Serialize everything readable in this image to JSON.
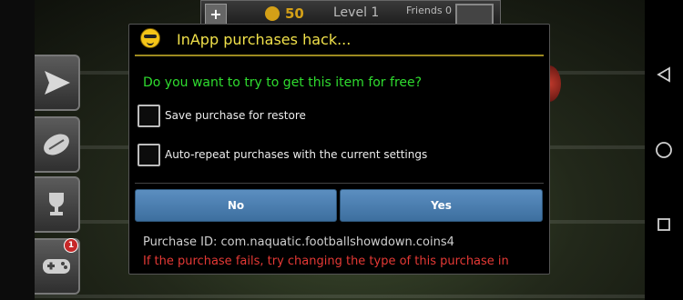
{
  "game": {
    "coins": "50",
    "level": "Level 1",
    "friends": "Friends 0",
    "notification_count": "1"
  },
  "dialog": {
    "icon": "smiley-glasses-icon",
    "title": "InApp purchases hack...",
    "question": "Do you want to try to get this item for free?",
    "checkboxes": [
      {
        "label": "Save purchase for restore",
        "checked": false
      },
      {
        "label": "Auto-repeat purchases with the current settings",
        "checked": false
      }
    ],
    "buttons": {
      "no": "No",
      "yes": "Yes"
    },
    "purchase_id": "Purchase ID: com.naquatic.footballshowdown.coins4",
    "warning": "If the purchase fails, try changing the type of this purchase in"
  },
  "navbar": {
    "back": "back-triangle-icon",
    "home": "home-circle-icon",
    "recents": "recents-square-icon"
  },
  "colors": {
    "title": "#f0e04a",
    "question": "#2fdc2f",
    "warning": "#e53935",
    "button": "#4a7fb2"
  }
}
